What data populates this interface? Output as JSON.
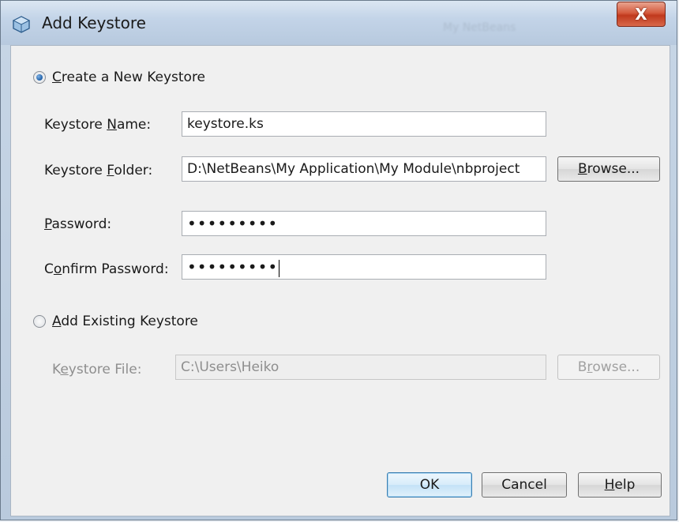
{
  "window": {
    "title": "Add Keystore",
    "background_title": "My NetBeans",
    "close_symbol": "X"
  },
  "create": {
    "radio_label": "Create a New Keystore",
    "selected": true,
    "name_label": "Keystore Name:",
    "name_value": "keystore.ks",
    "folder_label": "Keystore Folder:",
    "folder_value": "D:\\NetBeans\\My Application\\My Module\\nbproject",
    "browse_label": "Browse...",
    "password_label": "Password:",
    "password_value": "•••••••••",
    "confirm_label": "Confirm Password:",
    "confirm_value": "•••••••••"
  },
  "existing": {
    "radio_label": "Add Existing Keystore",
    "selected": false,
    "file_label": "Keystore File:",
    "file_value": "C:\\Users\\Heiko",
    "browse_label": "Browse..."
  },
  "buttons": {
    "ok": "OK",
    "cancel": "Cancel",
    "help": "Help"
  },
  "icons": {
    "title_icon": "netbeans-cube-icon",
    "close_icon": "close-icon"
  }
}
